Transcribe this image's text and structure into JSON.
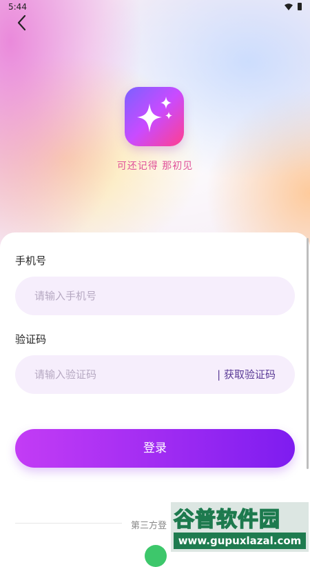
{
  "status_bar": {
    "time": "5:44"
  },
  "app": {
    "slogan": "可还记得 那初见"
  },
  "form": {
    "phone_label": "手机号",
    "phone_placeholder": "请输入手机号",
    "code_label": "验证码",
    "code_placeholder": "请输入验证码",
    "get_code_label": "| 获取验证码",
    "login_label": "登录"
  },
  "third_party": {
    "label": "第三方登"
  },
  "watermark": {
    "title": "谷普软件园",
    "url": "www.gupuxlazal.com"
  },
  "colors": {
    "accent": "#9e2bf2",
    "slogan": "#e0529a",
    "field_bg": "#f6eefc",
    "wechat": "#3dc76b"
  },
  "icons": {
    "back": "chevron-left-icon",
    "logo": "sparkles-icon",
    "wifi": "wifi-icon",
    "battery": "battery-icon",
    "wechat": "wechat-icon"
  }
}
